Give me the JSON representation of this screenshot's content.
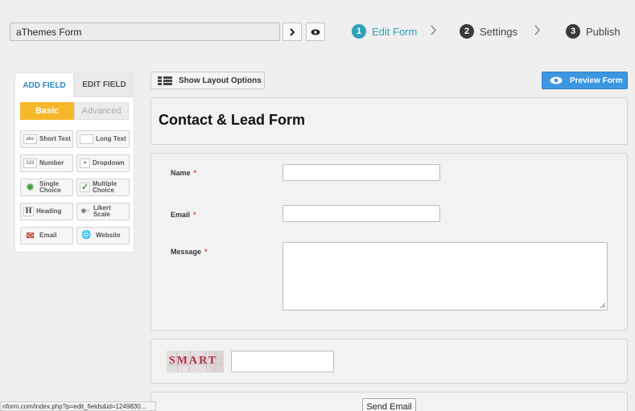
{
  "header": {
    "form_name": "aThemes Form",
    "steps": [
      {
        "num": "1",
        "label": "Edit Form"
      },
      {
        "num": "2",
        "label": "Settings"
      },
      {
        "num": "3",
        "label": "Publish"
      }
    ]
  },
  "left_panel": {
    "tabs": {
      "add": "ADD FIELD",
      "edit": "EDIT FIELD"
    },
    "subtabs": {
      "basic": "Basic",
      "advanced": "Advanced"
    },
    "fields": [
      {
        "label": "Short Text",
        "icon": "abc"
      },
      {
        "label": "Long Text",
        "icon": ""
      },
      {
        "label": "Number",
        "icon": "123"
      },
      {
        "label": "Dropdown",
        "icon": "▾"
      },
      {
        "label": "Single Choice",
        "icon": "◉"
      },
      {
        "label": "Multiple Choice",
        "icon": "✓"
      },
      {
        "label": "Heading",
        "icon": "H"
      },
      {
        "label": "Likert Scale",
        "icon": "◉○"
      },
      {
        "label": "Email",
        "icon": "✉"
      },
      {
        "label": "Website",
        "icon": "🌐"
      }
    ]
  },
  "toolbar": {
    "layout_label": "Show Layout Options",
    "preview_label": "Preview Form"
  },
  "form": {
    "title": "Contact & Lead Form",
    "fields": [
      {
        "label": "Name",
        "required": "*"
      },
      {
        "label": "Email",
        "required": "*"
      },
      {
        "label": "Message",
        "required": "*"
      }
    ],
    "captcha_text": "SMART",
    "send_label": "Send Email"
  },
  "status_url": "nform.com/index.php?p=edit_fields&id=1249830...",
  "colors": {
    "accent": "#2fa0ba",
    "basic_tab": "#f7b72a",
    "preview": "#3d97e0",
    "required": "#dd4433"
  }
}
